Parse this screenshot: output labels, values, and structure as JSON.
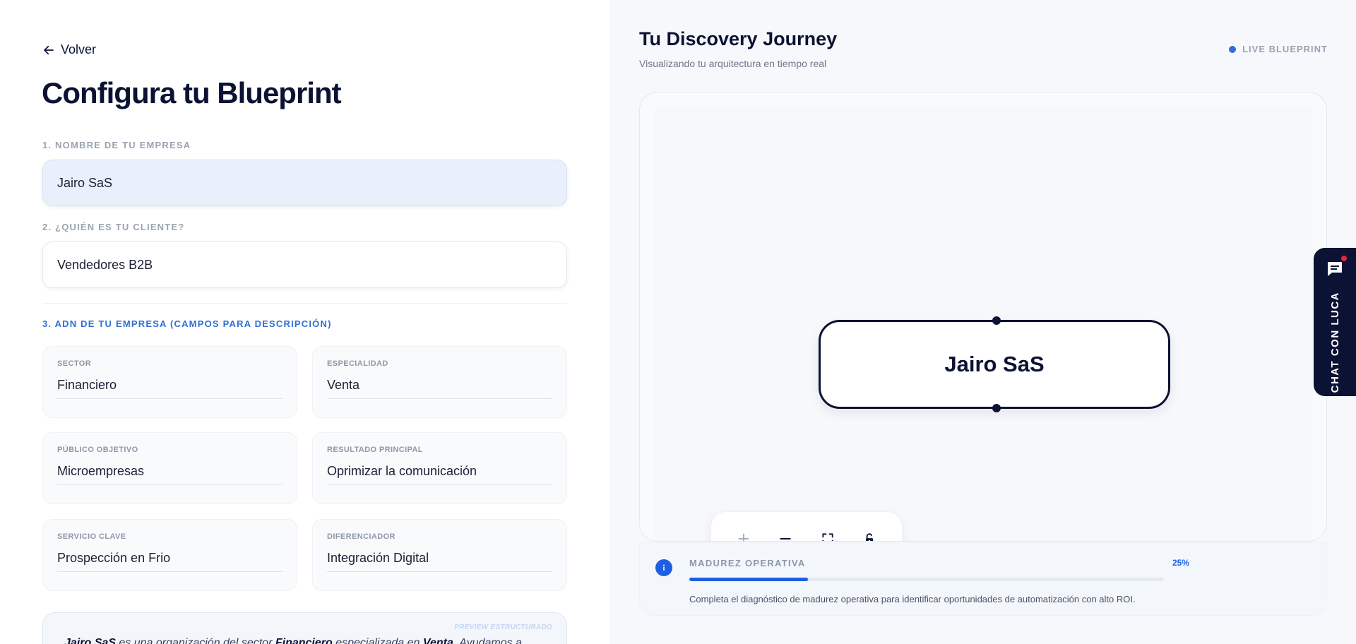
{
  "left": {
    "back_label": "Volver",
    "title": "Configura tu Blueprint",
    "step1_label": "1. NOMBRE DE TU EMPRESA",
    "company_name": "Jairo SaS",
    "step2_label": "2. ¿QUIÉN ES TU CLIENTE?",
    "client": "Vendedores B2B",
    "step3_label": "3. ADN DE TU EMPRESA (CAMPOS PARA DESCRIPCIÓN)",
    "cards": [
      {
        "label": "SECTOR",
        "value": "Financiero"
      },
      {
        "label": "ESPECIALIDAD",
        "value": "Venta"
      },
      {
        "label": "PÚBLICO OBJETIVO",
        "value": "Microempresas"
      },
      {
        "label": "RESULTADO PRINCIPAL",
        "value": "Oprimizar la comunicación"
      },
      {
        "label": "SERVICIO CLAVE",
        "value": "Prospección en Frio"
      },
      {
        "label": "DIFERENCIADOR",
        "value": "Integración Digital"
      }
    ],
    "preview": {
      "tag": "PREVIEW ESTRUCTURADO",
      "company": "Jairo SaS",
      "t1": " es una organización del sector ",
      "sector": "Financiero",
      "t2": " especializada en ",
      "specialty": "Venta",
      "t3": ". Ayudamos a"
    }
  },
  "right": {
    "title": "Tu Discovery Journey",
    "subtitle": "Visualizando tu arquitectura en tiempo real",
    "live_label": "LIVE BLUEPRINT",
    "node_label": "Jairo SaS",
    "maturity_label": "MADUREZ OPERATIVA",
    "maturity_percent_text": "25%",
    "maturity_fraction": 0.25,
    "maturity_desc": "Completa el diagnóstico de madurez operativa para identificar oportunidades de automatización con alto ROI."
  },
  "chat": {
    "label": "CHAT CON LUCA"
  },
  "colors": {
    "accent": "#1e5fe0",
    "navy": "#0c1233",
    "badge": "#e0283c"
  }
}
